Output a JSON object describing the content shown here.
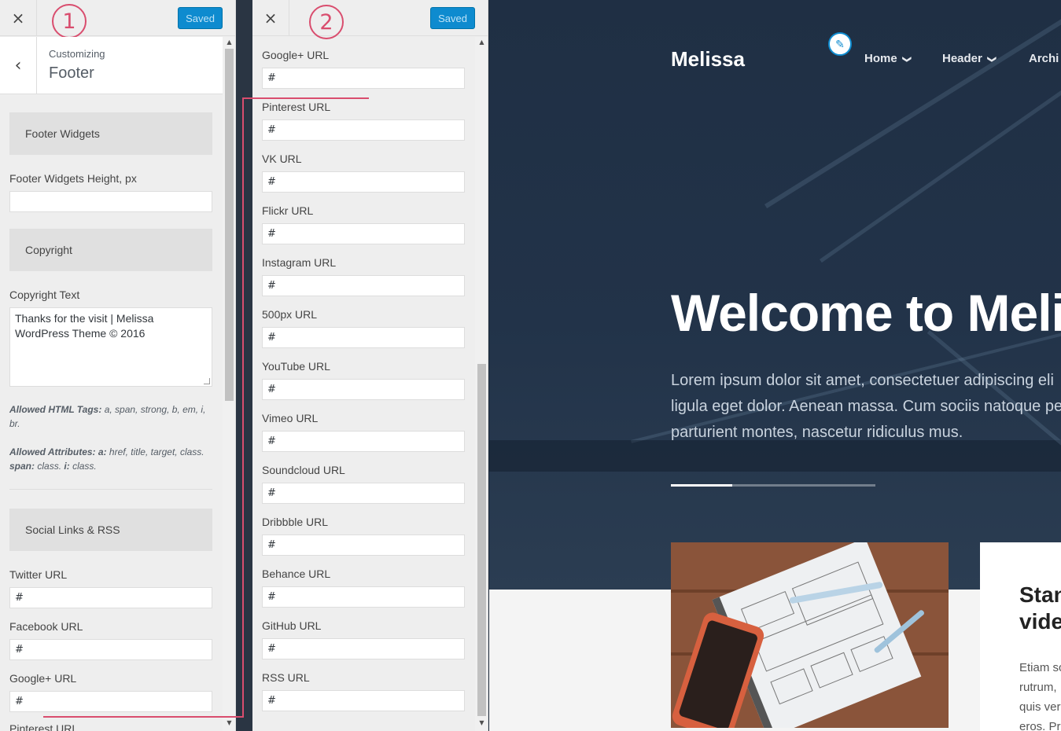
{
  "panel1": {
    "close_icon": "×",
    "saved_label": "Saved",
    "step": "1",
    "back_icon": "‹",
    "customizing_label": "Customizing",
    "section_title": "Footer",
    "sections": {
      "footer_widgets": "Footer Widgets",
      "copyright": "Copyright",
      "social": "Social Links & RSS"
    },
    "fields": {
      "widgets_height_label": "Footer Widgets Height, px",
      "widgets_height_value": "",
      "copyright_text_label": "Copyright Text",
      "copyright_text_value": "Thanks for the visit | Melissa WordPress Theme © 2016",
      "allowed_tags_label": "Allowed HTML Tags:",
      "allowed_tags_value": "a, span, strong, b, em, i, br.",
      "allowed_attrs_label": "Allowed Attributes:",
      "attr_a_label": "a:",
      "attr_a_value": "href, title, target, class.",
      "attr_span_label": "span:",
      "attr_span_value": "class.",
      "attr_i_label": "i:",
      "attr_i_value": "class."
    },
    "social_fields": [
      {
        "label": "Twitter URL",
        "value": "#"
      },
      {
        "label": "Facebook URL",
        "value": "#"
      },
      {
        "label": "Google+ URL",
        "value": "#"
      },
      {
        "label": "Pinterest URL",
        "value": ""
      }
    ]
  },
  "panel2": {
    "close_icon": "×",
    "saved_label": "Saved",
    "step": "2",
    "social_fields": [
      {
        "label": "Google+ URL",
        "value": "#"
      },
      {
        "label": "Pinterest URL",
        "value": "#"
      },
      {
        "label": "VK URL",
        "value": "#"
      },
      {
        "label": "Flickr URL",
        "value": "#"
      },
      {
        "label": "Instagram URL",
        "value": "#"
      },
      {
        "label": "500px URL",
        "value": "#"
      },
      {
        "label": "YouTube URL",
        "value": "#"
      },
      {
        "label": "Vimeo URL",
        "value": "#"
      },
      {
        "label": "Soundcloud URL",
        "value": "#"
      },
      {
        "label": "Dribbble URL",
        "value": "#"
      },
      {
        "label": "Behance URL",
        "value": "#"
      },
      {
        "label": "GitHub URL",
        "value": "#"
      },
      {
        "label": "RSS URL",
        "value": "#"
      }
    ]
  },
  "preview": {
    "brand": "Melissa",
    "edit_icon": "pencil-icon",
    "nav": [
      {
        "label": "Home",
        "chevron": "❯"
      },
      {
        "label": "Header",
        "chevron": "❯"
      },
      {
        "label": "Archi",
        "chevron": ""
      }
    ],
    "hero_title": "Welcome to Meli",
    "hero_text": [
      "Lorem ipsum dolor sit amet, consectetuer adipiscing eli",
      "ligula eget dolor. Aenean massa. Cum sociis natoque pe",
      "parturient montes, nascetur ridiculus mus."
    ],
    "slider_progress": 0.3,
    "card_title": [
      "Stan",
      "vide"
    ],
    "card_text": [
      "Etiam sc",
      "rutrum,",
      "quis ver",
      "eros. Pr"
    ]
  },
  "colors": {
    "accent": "#0e8bcf",
    "annotation": "#d94d6e",
    "panel_bg": "#eeeeee",
    "hero_bg": "#1f2f44"
  }
}
